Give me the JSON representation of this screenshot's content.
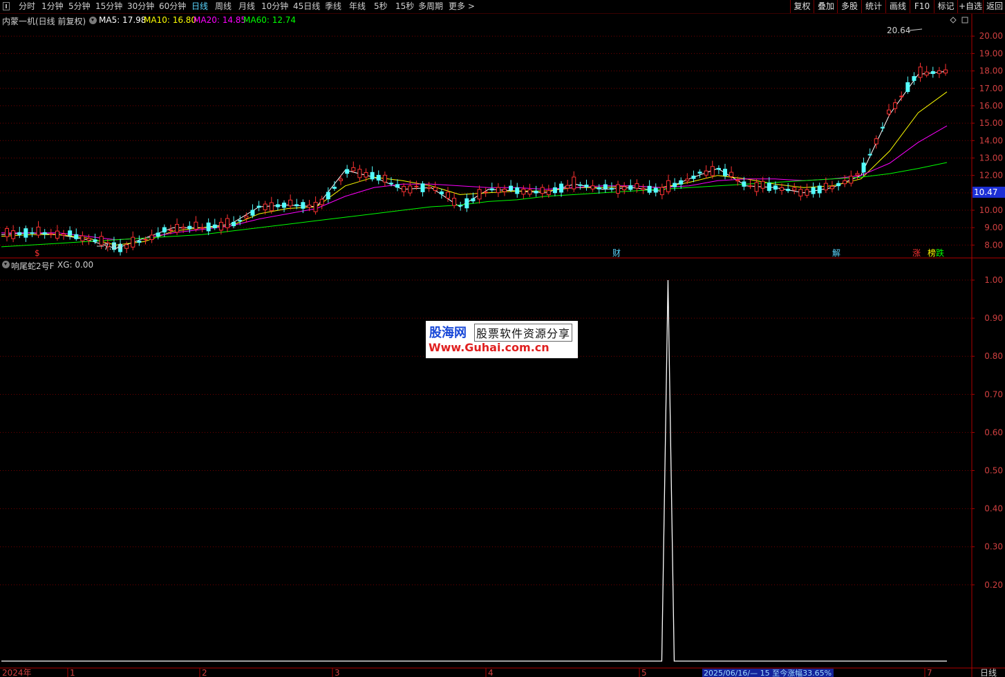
{
  "toolbar": {
    "periods": [
      "分时",
      "1分钟",
      "5分钟",
      "15分钟",
      "30分钟",
      "60分钟",
      "日线",
      "周线",
      "月线",
      "10分钟",
      "45日线",
      "季线",
      "年线",
      "5秒",
      "15秒",
      "多周期",
      "更多 >"
    ],
    "active_period": "日线",
    "right_buttons": [
      "复权",
      "叠加",
      "多股",
      "统计",
      "画线",
      "F10",
      "标记",
      "+自选",
      "返回"
    ]
  },
  "main_chart": {
    "title": "内蒙一机(日线 前复权)",
    "ma": [
      {
        "label": "MA5: 17.98",
        "color": "#ffffff"
      },
      {
        "label": "MA10: 16.80",
        "color": "#ffff00"
      },
      {
        "label": "MA20: 14.85",
        "color": "#ff00ff"
      },
      {
        "label": "MA60: 12.74",
        "color": "#00ff00"
      }
    ],
    "high_label": "20.64",
    "low_label": "7.64",
    "price_marker": "10.47",
    "events": [
      {
        "label": "$",
        "color": "#ff3333"
      },
      {
        "label": "财",
        "color": "#5ad6ff"
      },
      {
        "label": "解",
        "color": "#5ad6ff"
      },
      {
        "label": "涨",
        "color": "#ff3333"
      },
      {
        "label": "榜",
        "color": "#ffff00"
      },
      {
        "label": "跌",
        "color": "#00ff00"
      }
    ]
  },
  "indicator": {
    "title": "响尾蛇2号F",
    "value_label": "XG: 0.00"
  },
  "bottom_bar": {
    "year_label": "2024年",
    "months": [
      "1",
      "2",
      "3",
      "4",
      "5",
      "7"
    ],
    "info": "2025/06/16/— 15 至今涨幅33.65%",
    "period": "日线"
  },
  "watermark": {
    "line1": "股海网",
    "line2": "股票软件资源分享",
    "line3": "Www.Guhai.com.cn"
  },
  "chart_data": [
    {
      "type": "line",
      "title": "内蒙一机(日线 前复权)",
      "y_ticks": [
        8.0,
        9.0,
        10.0,
        11.0,
        12.0,
        13.0,
        14.0,
        15.0,
        16.0,
        17.0,
        18.0,
        19.0,
        20.0
      ],
      "ylim": [
        7.3,
        21.2
      ],
      "grid": true,
      "series": [
        {
          "name": "MA5",
          "color": "#ffffff",
          "values": [
            8.6,
            8.7,
            8.6,
            8.3,
            7.8,
            8.4,
            9.0,
            9.0,
            9.2,
            10.2,
            10.3,
            10.2,
            12.3,
            11.9,
            11.2,
            11.3,
            10.2,
            11.2,
            11.1,
            11.0,
            11.5,
            11.2,
            11.3,
            11.1,
            11.8,
            12.4,
            11.4,
            11.3,
            11.0,
            11.3,
            12.0,
            15.5,
            17.8,
            17.98
          ]
        },
        {
          "name": "MA10",
          "color": "#ffff00",
          "values": [
            8.5,
            8.6,
            8.6,
            8.4,
            8.0,
            8.2,
            8.8,
            9.0,
            9.1,
            9.8,
            10.1,
            10.2,
            11.4,
            11.9,
            11.7,
            11.4,
            10.9,
            11.0,
            11.1,
            11.1,
            11.3,
            11.3,
            11.4,
            11.3,
            11.6,
            12.0,
            11.8,
            11.5,
            11.3,
            11.4,
            11.8,
            13.4,
            15.6,
            16.8
          ]
        },
        {
          "name": "MA20",
          "color": "#ff00ff",
          "values": [
            8.7,
            8.7,
            8.7,
            8.5,
            8.3,
            8.4,
            8.7,
            8.9,
            9.1,
            9.5,
            9.8,
            10.1,
            10.8,
            11.3,
            11.5,
            11.5,
            11.4,
            11.3,
            11.3,
            11.2,
            11.3,
            11.4,
            11.4,
            11.3,
            11.4,
            11.7,
            11.8,
            11.8,
            11.7,
            11.8,
            12.0,
            12.7,
            13.9,
            14.85
          ]
        },
        {
          "name": "MA60",
          "color": "#00ff00",
          "values": [
            7.9,
            8.0,
            8.1,
            8.2,
            8.3,
            8.4,
            8.5,
            8.6,
            8.8,
            9.0,
            9.2,
            9.4,
            9.6,
            9.8,
            10.0,
            10.2,
            10.3,
            10.5,
            10.6,
            10.8,
            10.9,
            11.0,
            11.1,
            11.2,
            11.3,
            11.4,
            11.5,
            11.6,
            11.7,
            11.8,
            11.9,
            12.1,
            12.4,
            12.74
          ]
        }
      ]
    },
    {
      "type": "line",
      "title": "响尾蛇2号F",
      "y_ticks": [
        0.2,
        0.3,
        0.4,
        0.5,
        0.6,
        0.7,
        0.8,
        0.9,
        1.0
      ],
      "ylim": [
        0.0,
        1.02
      ],
      "grid": true,
      "series": [
        {
          "name": "XG",
          "color": "#ffffff",
          "signal_at_fraction": 0.705,
          "values": [
            0,
            1,
            0
          ]
        }
      ]
    }
  ]
}
